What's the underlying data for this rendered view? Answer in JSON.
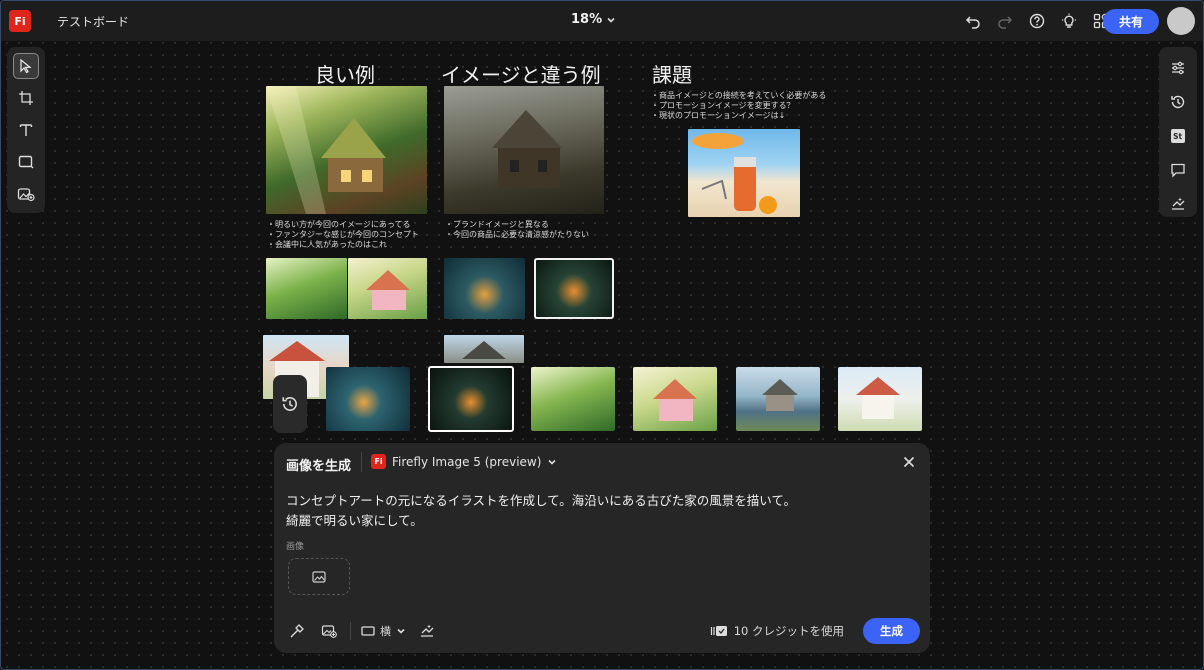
{
  "app": {
    "logo_text": "Fi",
    "document_title": "テストボード",
    "zoom": "18%",
    "share_label": "共有",
    "accent": "#3b63f5",
    "brand_color": "#e0261b"
  },
  "top_icons": [
    "undo-icon",
    "redo-icon",
    "help-icon",
    "lightbulb-icon",
    "apps-icon"
  ],
  "left_tools": [
    "select-tool",
    "frame-tool",
    "text-tool",
    "shape-tool",
    "generate-tool"
  ],
  "right_tools": [
    "adjust-icon",
    "history-icon",
    "stock-icon",
    "comment-icon",
    "generate-settings-icon"
  ],
  "board": {
    "good_heading": "良い例",
    "bad_heading": "イメージと違う例",
    "task_heading": "課題",
    "good_notes": "・明るい方が今回のイメージにあってる\n・ファンタジーな感じが今回のコンセプト\n・会議中に人気があったのはこれ",
    "bad_notes": "・ブランドイメージと異なる\n・今回の商品に必要な清涼感がたりない",
    "task_notes": "・商品イメージとの接続を考えていく必要がある\n・プロモーションイメージを変更する？\n・現状のプロモーションイメージは↓"
  },
  "panel": {
    "title": "画像を生成",
    "model_logo": "Fi",
    "model": "Firefly Image 5 (preview)",
    "prompt_line1": "コンセプトアートの元になるイラストを作成して。海沿いにある古びた家の風景を描いて。",
    "prompt_line2": "綺麗で明るい家にして。",
    "image_label": "画像",
    "ratio": "横",
    "credits": "10 クレジットを使用",
    "generate_label": "生成"
  }
}
